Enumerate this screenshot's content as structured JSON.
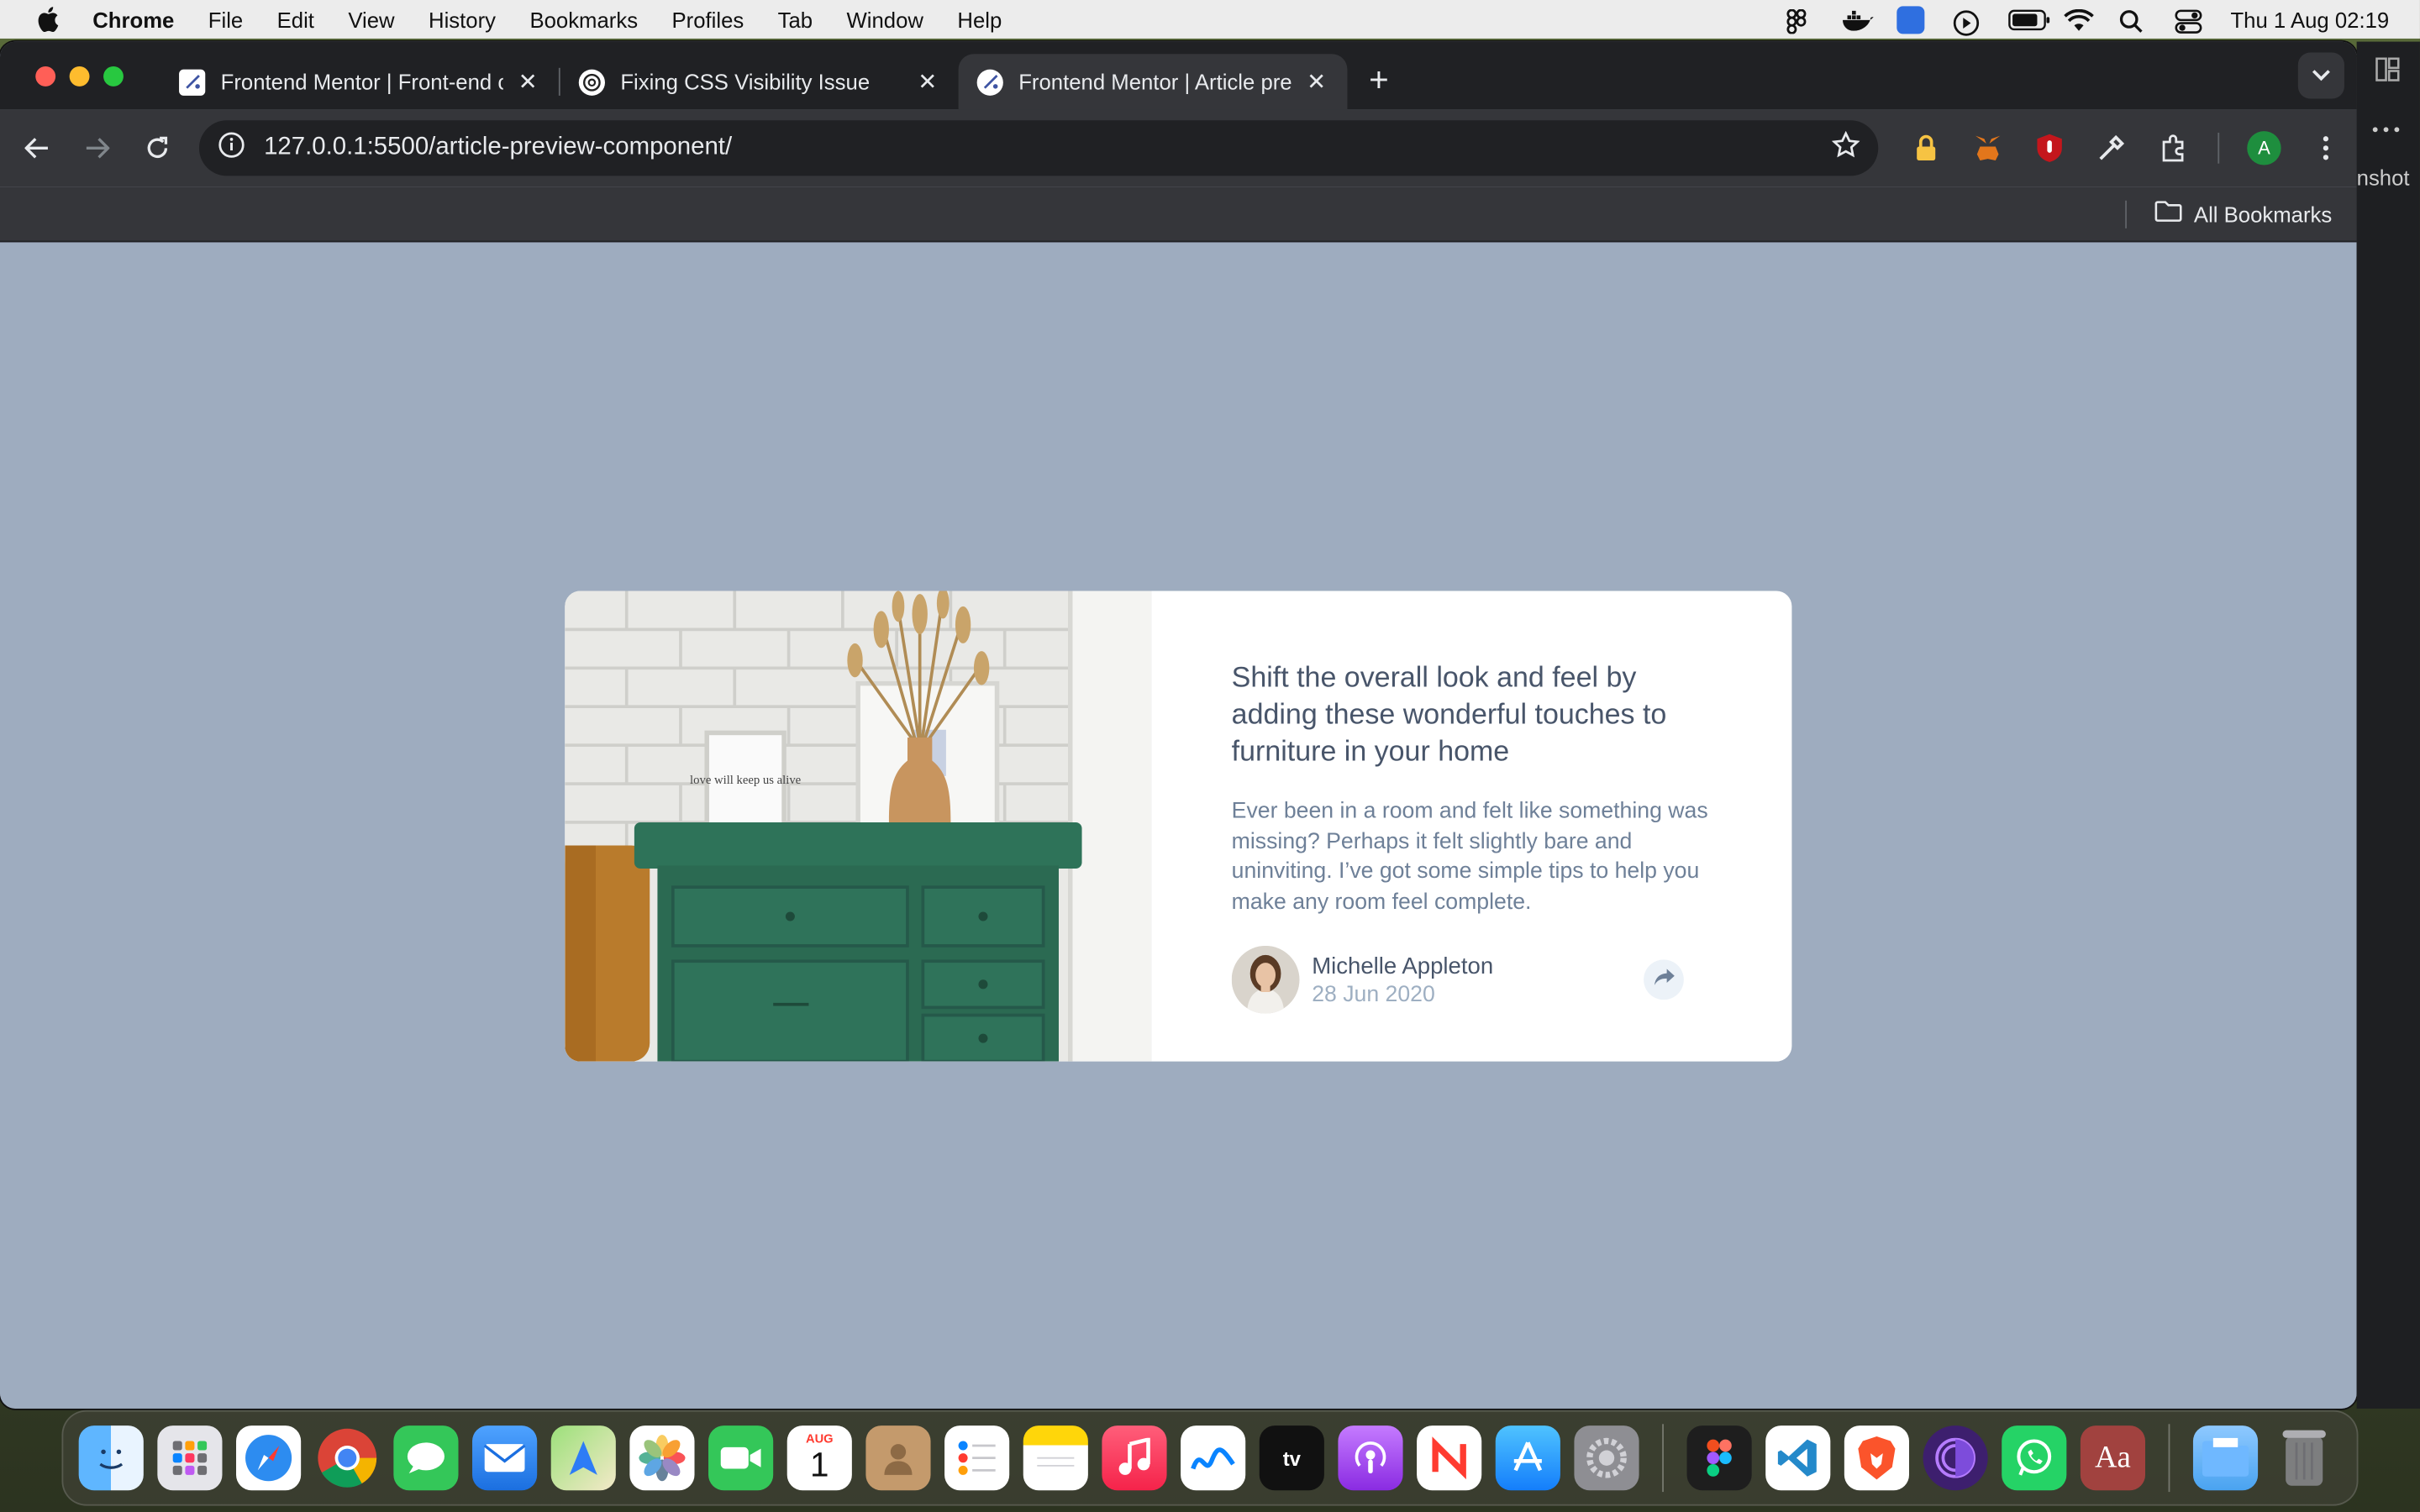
{
  "menubar": {
    "app": "Chrome",
    "items": [
      "File",
      "Edit",
      "View",
      "History",
      "Bookmarks",
      "Profiles",
      "Tab",
      "Window",
      "Help"
    ],
    "datetime": "Thu 1 Aug  02:19"
  },
  "browser": {
    "tabs": [
      {
        "title": "Frontend Mentor | Front-end c",
        "active": false
      },
      {
        "title": "Fixing CSS Visibility Issue",
        "active": false
      },
      {
        "title": "Frontend Mentor | Article prev",
        "active": true
      }
    ],
    "url": "127.0.0.1:5500/article-preview-component/",
    "bookmarks_label": "All Bookmarks",
    "profile_initial": "A"
  },
  "article": {
    "title": "Shift the overall look and feel by adding these wonderful touches to furniture in your home",
    "description": "Ever been in a room and felt like something was missing? Perhaps it felt slightly bare and uninviting. I’ve got some simple tips to help you make any room feel complete.",
    "author_name": "Michelle Appleton",
    "date": "28 Jun 2020",
    "frame_text": "love will keep us alive"
  },
  "side_window": {
    "text": "nshot"
  },
  "dock": {
    "apps": [
      "finder",
      "launchpad",
      "safari",
      "chrome",
      "messages",
      "mail",
      "maps",
      "photos",
      "facetime",
      "calendar",
      "contacts",
      "reminders",
      "notes",
      "music",
      "freeform",
      "tv",
      "podcasts",
      "news",
      "app-store",
      "system-settings",
      "figma",
      "vscode",
      "brave",
      "tor",
      "whatsapp",
      "dictionary",
      "downloads",
      "trash"
    ],
    "calendar_month": "AUG",
    "calendar_day": "1"
  },
  "colors": {
    "page_bg": "#9eacbf",
    "card_bg": "#ffffff",
    "title": "#48556a",
    "body": "#6e8098",
    "muted": "#9eafc2"
  }
}
